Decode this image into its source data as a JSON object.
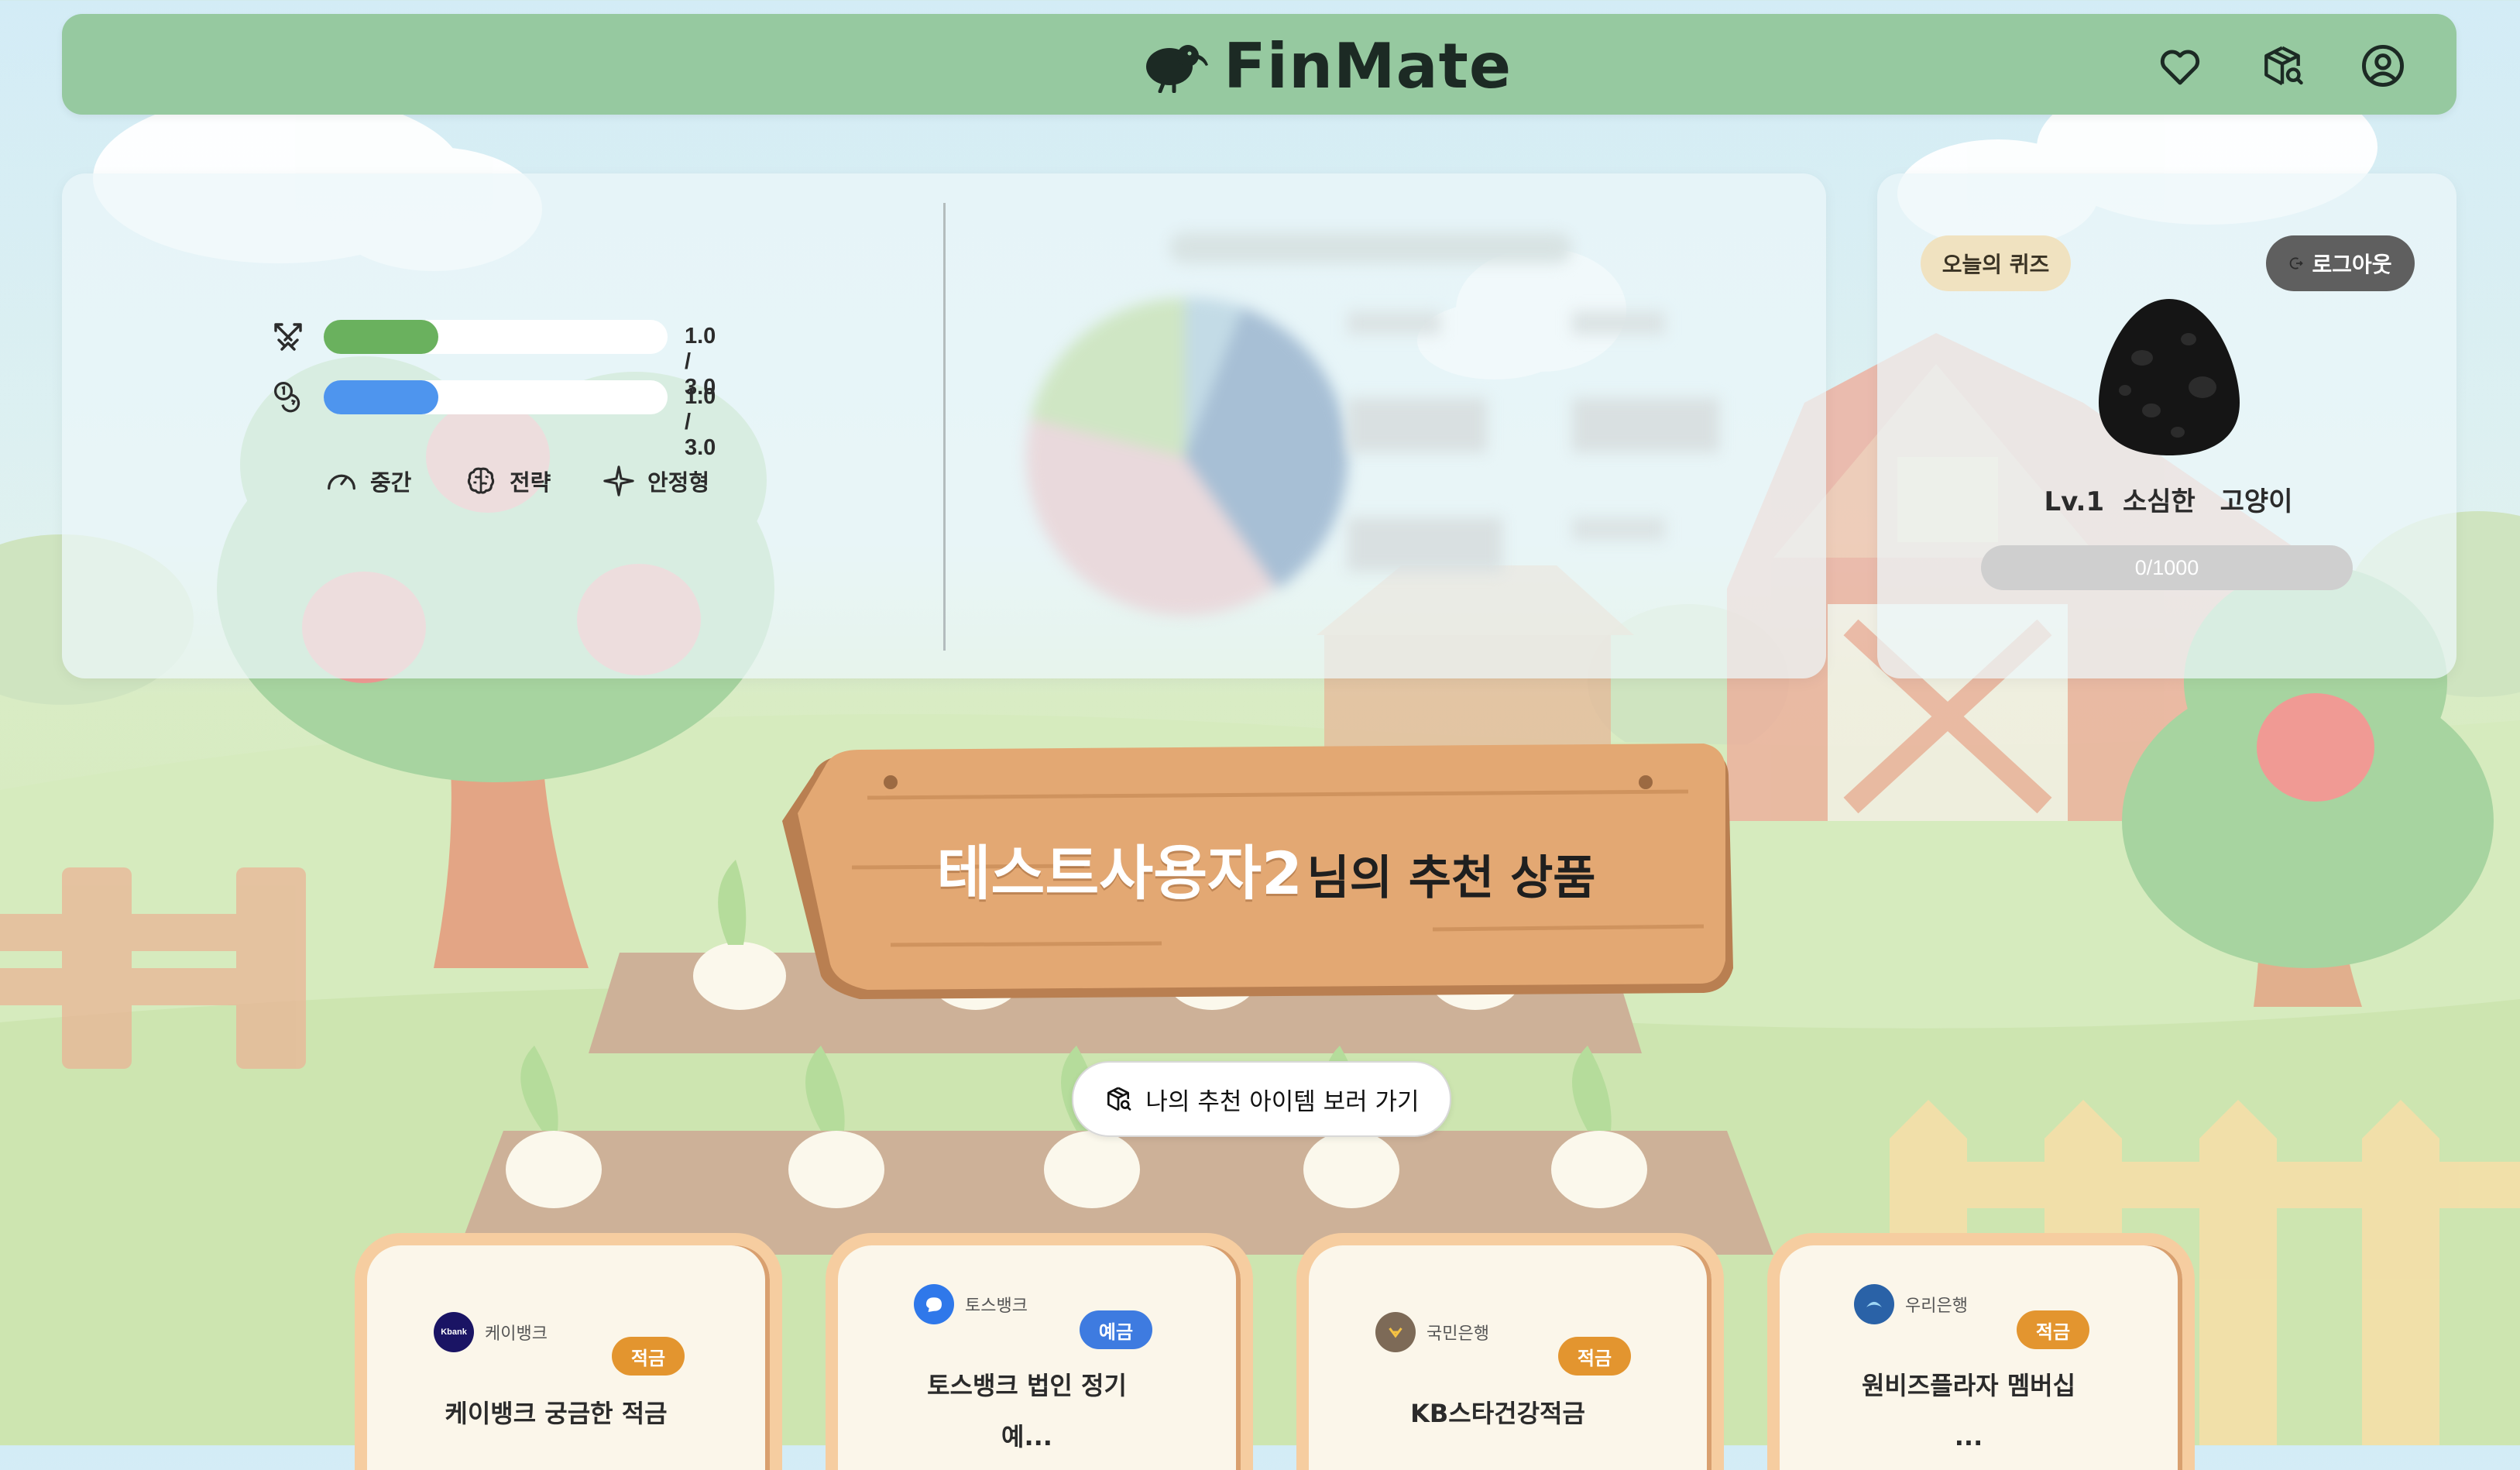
{
  "app": {
    "title": "FinMate"
  },
  "header": {
    "icons": [
      "heart-icon",
      "box-search-icon",
      "user-circle-icon"
    ]
  },
  "stats": {
    "bars": [
      {
        "icon": "swords-icon",
        "value_text": "1.0 / 3.0",
        "fraction": 0.333,
        "color": "#6ab15e"
      },
      {
        "icon": "coins-icon",
        "value_text": "1.0 / 3.0",
        "fraction": 0.333,
        "color": "#4e95ee"
      }
    ],
    "tags": [
      {
        "icon": "gauge-icon",
        "label": "중간"
      },
      {
        "icon": "brain-icon",
        "label": "전략"
      },
      {
        "icon": "sparkle-icon",
        "label": "안정형"
      }
    ]
  },
  "profile": {
    "quiz_label": "오늘의 퀴즈",
    "logout_label": "로그아웃",
    "level": "Lv.1",
    "title_part1": "소심한",
    "title_part2": "고양이",
    "xp_text": "0/1000",
    "colors": {
      "quiz_bg": "#f0e2c0",
      "logout_bg": "#5f5f5f",
      "xp_bg": "#cfcfcf"
    }
  },
  "banner": {
    "user_name": "테스트사용자2",
    "suffix": "님의 추천 상품",
    "cta_label": "나의 추천 아이템 보러 가기"
  },
  "products": [
    {
      "bank": "케이뱅크",
      "logo_text": "Kbank",
      "logo_color": "#1a1464",
      "type": "적금",
      "type_color": "#e3952f",
      "name": "케이뱅크 궁금한 적금"
    },
    {
      "bank": "토스뱅크",
      "logo_text": "",
      "logo_color": "#2f78ea",
      "type": "예금",
      "type_color": "#3e7be0",
      "name": "토스뱅크 법인 정기",
      "name2": "예..."
    },
    {
      "bank": "국민은행",
      "logo_text": "",
      "logo_color": "#7d6a57",
      "type": "적금",
      "type_color": "#e3952f",
      "name": "KB스타건강적금"
    },
    {
      "bank": "우리은행",
      "logo_text": "",
      "logo_color": "#2a62a7",
      "type": "적금",
      "type_color": "#e3952f",
      "name": "원비즈플라자 멤버십",
      "name2": "..."
    }
  ]
}
